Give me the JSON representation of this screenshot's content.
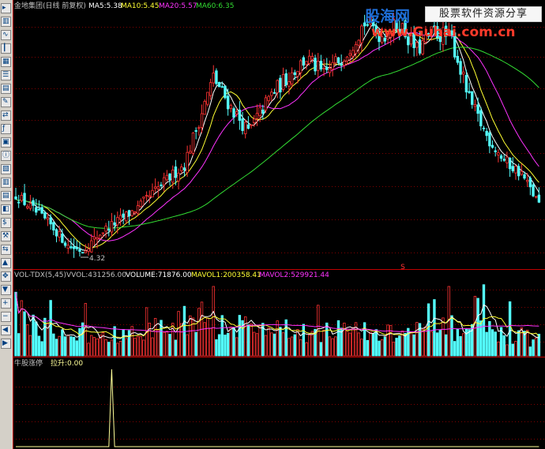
{
  "toolbar": {
    "icons": [
      {
        "name": "cursor-icon",
        "glyph": "▸"
      },
      {
        "name": "chart-icon",
        "glyph": "▥"
      },
      {
        "name": "line-chart-icon",
        "glyph": "∿"
      },
      {
        "name": "kline-icon",
        "glyph": "┃"
      },
      {
        "name": "grid-icon",
        "glyph": "▦"
      },
      {
        "name": "list-icon",
        "glyph": "☰"
      },
      {
        "name": "table-icon",
        "glyph": "▤"
      },
      {
        "name": "note-icon",
        "glyph": "✎"
      },
      {
        "name": "compare-icon",
        "glyph": "⇄"
      },
      {
        "name": "indicator-icon",
        "glyph": "ƒ"
      },
      {
        "name": "calc-icon",
        "glyph": "▣"
      },
      {
        "name": "info-icon",
        "glyph": "ⓘ"
      },
      {
        "name": "report-icon",
        "glyph": "▧"
      },
      {
        "name": "tick-icon",
        "glyph": "▥"
      },
      {
        "name": "bst-icon",
        "glyph": "▤"
      },
      {
        "name": "analysis-icon",
        "glyph": "◧"
      },
      {
        "name": "money-icon",
        "glyph": "$"
      },
      {
        "name": "tools-icon",
        "glyph": "⚒"
      },
      {
        "name": "trade-icon",
        "glyph": "⇆"
      },
      {
        "name": "up-arrow-icon",
        "glyph": "▲"
      },
      {
        "name": "move-icon",
        "glyph": "✥"
      },
      {
        "name": "down-arrow-icon",
        "glyph": "▼"
      },
      {
        "name": "zoom-in-icon",
        "glyph": "+"
      },
      {
        "name": "zoom-out-icon",
        "glyph": "−"
      },
      {
        "name": "left-arrow-icon",
        "glyph": "◀"
      },
      {
        "name": "right-arrow-icon",
        "glyph": "▶"
      }
    ]
  },
  "main_header": {
    "stock": "金地集团(日线 前复权)",
    "ma5": "MA5:5.38",
    "ma10": "MA10:5.45",
    "ma20": "MA20:5.57",
    "ma60": "MA60:6.35"
  },
  "low_annotation": "4.32",
  "volume_header": {
    "name": "VOL-TDX(5,45)",
    "vvol": "VVOL:431256.00",
    "volume": "VOLUME:71876.00",
    "mavol1": "MAVOL1:200358.41",
    "mavol2": "MAVOL2:529921.44"
  },
  "indicator_header": {
    "name": "牛股涨停",
    "value": "拉升:0.00"
  },
  "watermark": {
    "logo": "股海网",
    "slogan": "股票软件资源分享",
    "url": "www.Guhai.com.cn"
  },
  "colors": {
    "up": "#ff3333",
    "down": "#54ffff",
    "ma5": "#ffffff",
    "ma10": "#ffff33",
    "ma20": "#ff33ff",
    "ma60": "#33dd33",
    "grid": "#800000",
    "indicator_line": "#ffff99"
  },
  "chart_data": {
    "type": "candlestick",
    "price_axis_range": [
      3.9,
      10.6
    ],
    "low_marker": 4.32,
    "ma_last": {
      "MA5": 5.38,
      "MA10": 5.45,
      "MA20": 5.57,
      "MA60": 6.35
    },
    "volume_last": {
      "VVOL": 431256.0,
      "VOLUME": 71876.0,
      "MAVOL1": 200358.41,
      "MAVOL2": 529921.44
    },
    "indicator_last": {
      "拉升": 0.0
    },
    "price_keypoints": [
      [
        0,
        5.8
      ],
      [
        12,
        5.0
      ],
      [
        18,
        4.45
      ],
      [
        23,
        4.32
      ],
      [
        30,
        4.85
      ],
      [
        42,
        5.45
      ],
      [
        50,
        6.05
      ],
      [
        58,
        6.6
      ],
      [
        68,
        8.9
      ],
      [
        74,
        8.1
      ],
      [
        80,
        7.45
      ],
      [
        88,
        8.45
      ],
      [
        94,
        8.95
      ],
      [
        100,
        9.4
      ],
      [
        106,
        8.95
      ],
      [
        114,
        9.6
      ],
      [
        120,
        10.35
      ],
      [
        126,
        10.0
      ],
      [
        132,
        10.3
      ],
      [
        138,
        9.6
      ],
      [
        144,
        10.1
      ],
      [
        150,
        9.9
      ],
      [
        156,
        8.3
      ],
      [
        162,
        7.35
      ],
      [
        168,
        6.7
      ],
      [
        174,
        6.35
      ],
      [
        180,
        5.55
      ]
    ],
    "volume_keypoints": [
      [
        0,
        0.8
      ],
      [
        12,
        0.45
      ],
      [
        25,
        0.35
      ],
      [
        40,
        0.4
      ],
      [
        52,
        0.5
      ],
      [
        60,
        0.75
      ],
      [
        70,
        0.6
      ],
      [
        80,
        0.55
      ],
      [
        95,
        0.45
      ],
      [
        110,
        0.5
      ],
      [
        125,
        0.4
      ],
      [
        140,
        0.45
      ],
      [
        155,
        0.55
      ],
      [
        170,
        0.4
      ],
      [
        180,
        0.3
      ]
    ],
    "indicator_spike_bar": 33
  }
}
